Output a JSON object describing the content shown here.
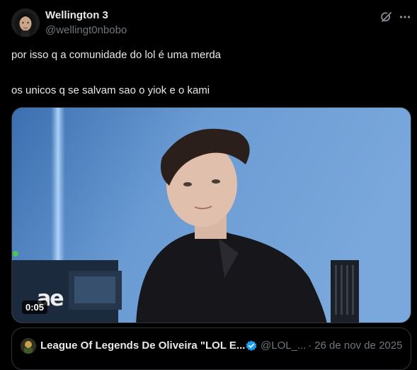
{
  "author": {
    "name": "Wellington 3",
    "handle": "@wellingt0nbobo"
  },
  "header_icons": [
    "grok-icon",
    "more-icon"
  ],
  "tweet": {
    "line1": "por isso q a comunidade do lol é uma merda",
    "line2": "os unicos q se salvam sao o yiok e o kami"
  },
  "media": {
    "type": "video",
    "duration": "0:05",
    "watermark": "ae"
  },
  "quoted_tweet": {
    "author_name": "League Of Legends De Oliveira \"LOL E...",
    "handle": "@LOL_...",
    "date": "· 26 de nov de 2025",
    "verified": true
  },
  "colors": {
    "background": "#000000",
    "text": "#e7e9ea",
    "secondary_text": "#71767b",
    "border": "#2f3336",
    "verified": "#1d9bf0"
  }
}
